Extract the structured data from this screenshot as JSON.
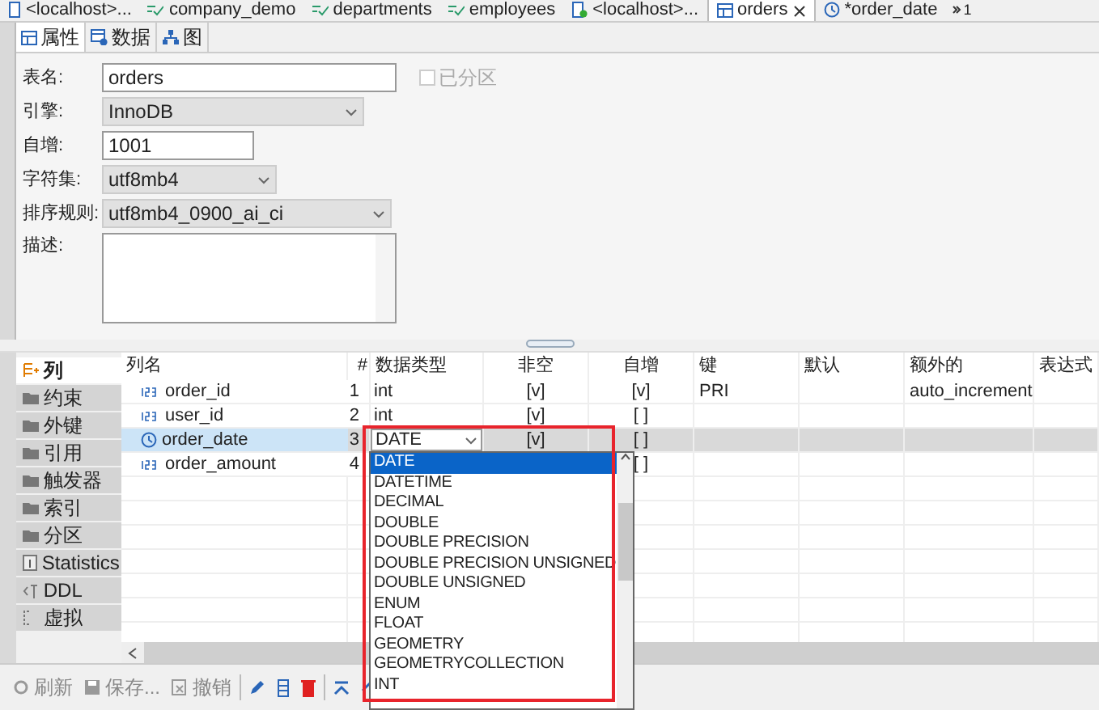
{
  "doc_tabs": [
    {
      "label": "<localhost>...",
      "kind": "host",
      "selected": false
    },
    {
      "label": "company_demo",
      "kind": "db",
      "selected": false
    },
    {
      "label": "departments",
      "kind": "db",
      "selected": false
    },
    {
      "label": "employees",
      "kind": "db",
      "selected": false
    },
    {
      "label": "<localhost>...",
      "kind": "script",
      "selected": false
    },
    {
      "label": "orders",
      "kind": "table",
      "selected": true,
      "closable": true
    },
    {
      "label": "*order_date",
      "kind": "clock",
      "selected": false
    }
  ],
  "tab_overflow": "1",
  "sub_tabs": [
    {
      "label": "属性",
      "kind": "table",
      "selected": true
    },
    {
      "label": "数据",
      "kind": "data",
      "selected": false
    },
    {
      "label": "图",
      "kind": "diagram",
      "selected": false
    }
  ],
  "form": {
    "table_name": {
      "label": "表名:",
      "value": "orders"
    },
    "partitioned": {
      "label": "已分区",
      "checked": false,
      "disabled": true
    },
    "engine": {
      "label": "引擎:",
      "value": "InnoDB"
    },
    "auto_increment": {
      "label": "自增:",
      "value": "1001"
    },
    "charset": {
      "label": "字符集:",
      "value": "utf8mb4"
    },
    "collation": {
      "label": "排序规则:",
      "value": "utf8mb4_0900_ai_ci"
    },
    "comment": {
      "label": "描述:"
    }
  },
  "side_tabs": [
    {
      "label": "列",
      "kind": "columns",
      "selected": true
    },
    {
      "label": "约束",
      "kind": "folder",
      "selected": false
    },
    {
      "label": "外键",
      "kind": "folder",
      "selected": false
    },
    {
      "label": "引用",
      "kind": "folder",
      "selected": false
    },
    {
      "label": "触发器",
      "kind": "folder",
      "selected": false
    },
    {
      "label": "索引",
      "kind": "folder",
      "selected": false
    },
    {
      "label": "分区",
      "kind": "folder",
      "selected": false
    },
    {
      "label": "Statistics",
      "kind": "stats",
      "selected": false
    },
    {
      "label": "DDL",
      "kind": "ddl",
      "selected": false
    },
    {
      "label": "虚拟",
      "kind": "virtual",
      "selected": false
    }
  ],
  "table": {
    "columns": [
      "列名",
      "#",
      "数据类型",
      "非空",
      "自增",
      "键",
      "默认",
      "额外的",
      "表达式"
    ],
    "rows": [
      {
        "kind": "number",
        "cells": [
          "order_id",
          "1",
          "int",
          "[v]",
          "[v]",
          "PRI",
          "",
          "auto_increment",
          ""
        ],
        "selected": false
      },
      {
        "kind": "number",
        "cells": [
          "user_id",
          "2",
          "int",
          "[v]",
          "[ ]",
          "",
          "",
          "",
          ""
        ],
        "selected": false
      },
      {
        "kind": "clock",
        "cells": [
          "order_date",
          "3",
          "DATE",
          "[v]",
          "[ ]",
          "",
          "",
          "",
          ""
        ],
        "selected": true
      },
      {
        "kind": "number",
        "cells": [
          "order_amount",
          "4",
          "",
          "",
          "[ ]",
          "",
          "",
          "",
          ""
        ],
        "selected": false
      }
    ]
  },
  "type_dropdown": {
    "items": [
      {
        "label": "DATE",
        "selected": true
      },
      {
        "label": "DATETIME",
        "selected": false
      },
      {
        "label": "DECIMAL",
        "selected": false
      },
      {
        "label": "DOUBLE",
        "selected": false
      },
      {
        "label": "DOUBLE PRECISION",
        "selected": false
      },
      {
        "label": "DOUBLE PRECISION UNSIGNED",
        "selected": false
      },
      {
        "label": "DOUBLE UNSIGNED",
        "selected": false
      },
      {
        "label": "ENUM",
        "selected": false
      },
      {
        "label": "FLOAT",
        "selected": false
      },
      {
        "label": "GEOMETRY",
        "selected": false
      },
      {
        "label": "GEOMETRYCOLLECTION",
        "selected": false
      },
      {
        "label": "INT",
        "selected": false
      }
    ],
    "highlighted": true
  },
  "toolbar": [
    {
      "label": "刷新",
      "kind": "refresh",
      "disabled": true
    },
    {
      "label": "保存...",
      "kind": "save",
      "disabled": true
    },
    {
      "label": "撤销",
      "kind": "undo",
      "disabled": true
    },
    {
      "kind": "pencil",
      "disabled": false
    },
    {
      "kind": "add",
      "disabled": false
    },
    {
      "kind": "delete",
      "disabled": false
    },
    {
      "kind": "top",
      "disabled": false
    },
    {
      "kind": "up",
      "disabled": false
    }
  ]
}
